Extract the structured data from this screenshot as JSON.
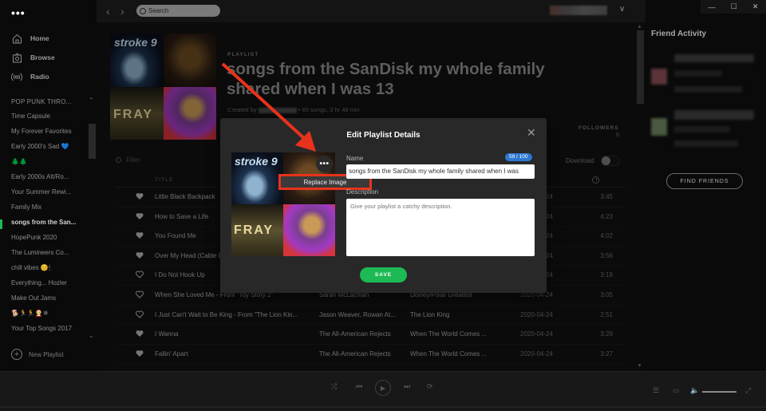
{
  "sidebar": {
    "menu_icon": "more-horizontal-icon",
    "nav": [
      {
        "label": "Home",
        "icon": "home-icon"
      },
      {
        "label": "Browse",
        "icon": "browse-icon"
      },
      {
        "label": "Radio",
        "icon": "radio-icon"
      }
    ],
    "playlists_header": "POP PUNK THRO...",
    "playlists": [
      "Time Capsule",
      "My Forever Favorites",
      "Early 2000's Sad 💙",
      "🌲🌲",
      "Early 2000s Alt/Ro...",
      "Your Summer Rewi...",
      "Family Mix",
      "songs from the San...",
      "HopePunk 2020",
      "The Lumineers Co...",
      "chill vibes 😊🕯",
      "Everything... Hozler",
      "Make Out Jams",
      "🐕🏃🏃🤶❄",
      "Your Top Songs 2017"
    ],
    "active_index": 7,
    "new_playlist_label": "New Playlist"
  },
  "topbar": {
    "back_icon": "chevron-left-icon",
    "forward_icon": "chevron-right-icon",
    "search_placeholder": "Search",
    "user_menu_icon": "chevron-down-icon"
  },
  "playlist": {
    "type_label": "PLAYLIST",
    "title": "songs from the SanDisk my whole family shared when I was 13",
    "created_by_label": "Created by",
    "meta": "• 60 songs, 3 hr 48 min",
    "followers_label": "FOLLOWERS",
    "followers_count": "0",
    "download_label": "Download",
    "download_enabled": false,
    "filter_placeholder": "Filter",
    "columns": {
      "title": "TITLE",
      "duration_icon": "clock-icon"
    },
    "cover_texts": {
      "c1": "stroke 9",
      "c3": "FRAY"
    }
  },
  "tracks": [
    {
      "title": "Little Black Backpack",
      "artist": "",
      "album": "",
      "date": "2020-04-24",
      "duration": "3:45",
      "liked": true
    },
    {
      "title": "How to Save a Life",
      "artist": "",
      "album": "",
      "date": "2020-04-24",
      "duration": "4:23",
      "liked": true
    },
    {
      "title": "You Found Me",
      "artist": "",
      "album": "",
      "date": "2020-04-24",
      "duration": "4:02",
      "liked": true
    },
    {
      "title": "Over My Head (Cable Car)",
      "artist": "",
      "album": "",
      "date": "2020-04-24",
      "duration": "3:56",
      "liked": true
    },
    {
      "title": "I Do Not Hook Up",
      "artist": "",
      "album": "",
      "date": "2020-04-24",
      "duration": "3:19",
      "liked": false
    },
    {
      "title": "When She Loved Me - From \"Toy Story 2\"",
      "artist": "Sarah McLachlan",
      "album": "Disney/Pixar Greatest",
      "date": "2020-04-24",
      "duration": "3:05",
      "liked": false
    },
    {
      "title": "I Just Can't Wait to Be King - From \"The Lion Kin...",
      "artist": "Jason Weaver, Rowan At...",
      "album": "The Lion King",
      "date": "2020-04-24",
      "duration": "2:51",
      "liked": false
    },
    {
      "title": "I Wanna",
      "artist": "The All-American Rejects",
      "album": "When The World Comes ...",
      "date": "2020-04-24",
      "duration": "3:29",
      "liked": true
    },
    {
      "title": "Fallin' Apart",
      "artist": "The All-American Rejects",
      "album": "When The World Comes ...",
      "date": "2020-04-24",
      "duration": "3:27",
      "liked": true
    }
  ],
  "friends": {
    "title": "Friend Activity",
    "find_friends_label": "FIND FRIENDS"
  },
  "window_controls": {
    "minimize": "—",
    "maximize": "☐",
    "close": "✕"
  },
  "modal": {
    "title": "Edit Playlist Details",
    "close_icon": "close-icon",
    "more_label": "•••",
    "context_menu_item": "Replace Image",
    "name_label": "Name",
    "name_counter": "59 / 100",
    "name_value": "songs from the SanDisk my whole family shared when I was",
    "description_label": "Description",
    "description_placeholder": "Give your playlist a catchy description.",
    "save_label": "SAVE"
  },
  "annotation": {
    "arrow_color": "#e8331c"
  },
  "colors": {
    "accent": "#1db954",
    "counter": "#2e77d0"
  },
  "player": {
    "shuffle": "shuffle-icon",
    "previous": "previous-icon",
    "play": "play-icon",
    "next": "next-icon",
    "repeat": "repeat-icon",
    "queue": "queue-icon",
    "devices": "devices-icon",
    "volume": "volume-icon",
    "fullscreen": "fullscreen-icon"
  }
}
